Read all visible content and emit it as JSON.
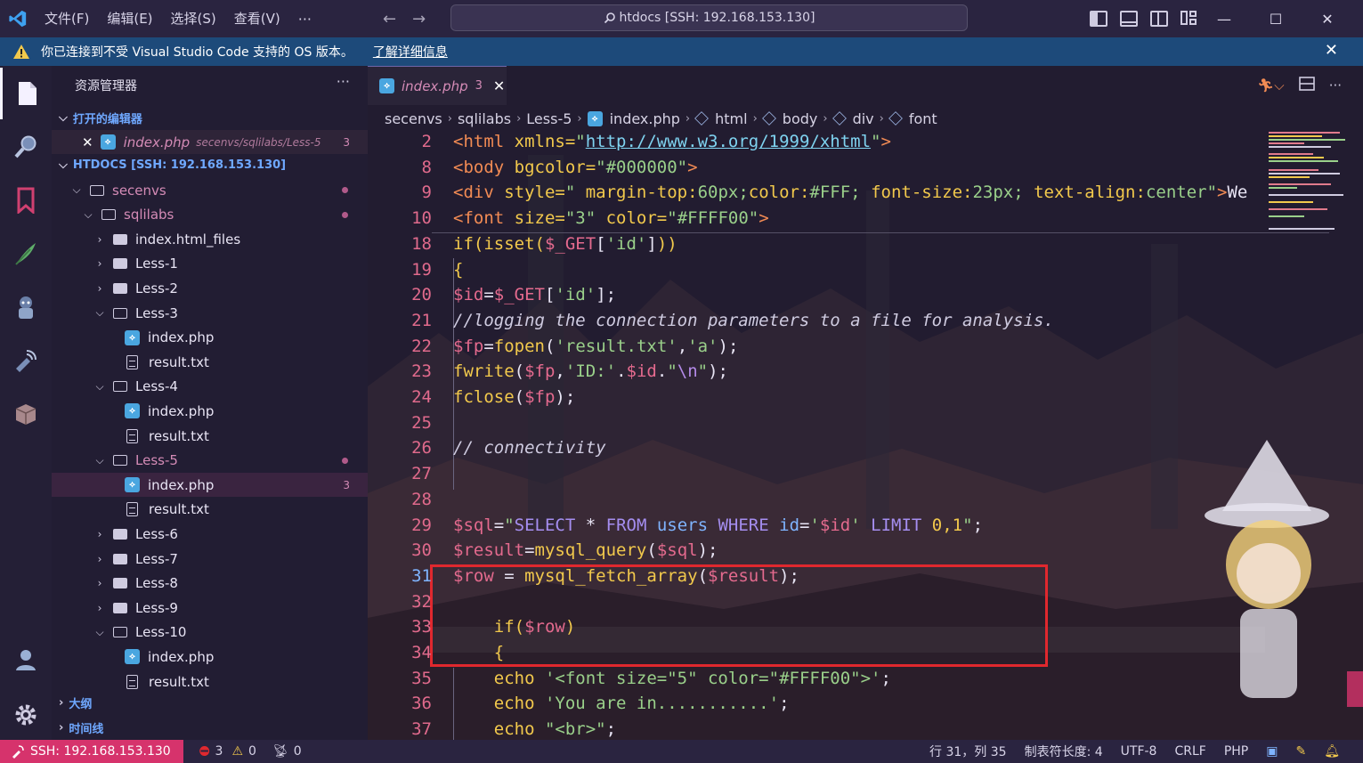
{
  "titlebar": {
    "menus": [
      "文件(F)",
      "编辑(E)",
      "选择(S)",
      "查看(V)"
    ],
    "more": "···",
    "search_text": "htdocs [SSH: 192.168.153.130]"
  },
  "notification": {
    "message": "你已连接到不受 Visual Studio Code 支持的 OS 版本。",
    "link": "了解详细信息"
  },
  "sidebar": {
    "title": "资源管理器",
    "more": "···",
    "open_editors_title": "打开的编辑器",
    "open_editor": {
      "name": "index.php",
      "path": "secenvs/sqlilabs/Less-5",
      "badge": "3"
    },
    "workspace_title": "HTDOCS [SSH: 192.168.153.130]",
    "tree": [
      {
        "label": "secenvs",
        "kind": "folder-open",
        "depth": 1,
        "modified": true
      },
      {
        "label": "sqlilabs",
        "kind": "folder-open",
        "depth": 2,
        "modified": true
      },
      {
        "label": "index.html_files",
        "kind": "folder",
        "depth": 3
      },
      {
        "label": "Less-1",
        "kind": "folder",
        "depth": 3
      },
      {
        "label": "Less-2",
        "kind": "folder",
        "depth": 3
      },
      {
        "label": "Less-3",
        "kind": "folder-open",
        "depth": 3
      },
      {
        "label": "index.php",
        "kind": "php",
        "depth": 4
      },
      {
        "label": "result.txt",
        "kind": "txt",
        "depth": 4
      },
      {
        "label": "Less-4",
        "kind": "folder-open",
        "depth": 3
      },
      {
        "label": "index.php",
        "kind": "php",
        "depth": 4
      },
      {
        "label": "result.txt",
        "kind": "txt",
        "depth": 4
      },
      {
        "label": "Less-5",
        "kind": "folder-open",
        "depth": 3,
        "modified": true
      },
      {
        "label": "index.php",
        "kind": "php",
        "depth": 4,
        "selected": true,
        "badge": "3"
      },
      {
        "label": "result.txt",
        "kind": "txt",
        "depth": 4
      },
      {
        "label": "Less-6",
        "kind": "folder",
        "depth": 3
      },
      {
        "label": "Less-7",
        "kind": "folder",
        "depth": 3
      },
      {
        "label": "Less-8",
        "kind": "folder",
        "depth": 3
      },
      {
        "label": "Less-9",
        "kind": "folder",
        "depth": 3
      },
      {
        "label": "Less-10",
        "kind": "folder-open",
        "depth": 3
      },
      {
        "label": "index.php",
        "kind": "php",
        "depth": 4
      },
      {
        "label": "result.txt",
        "kind": "txt",
        "depth": 4
      }
    ],
    "outline_title": "大纲",
    "timeline_title": "时间线"
  },
  "editor": {
    "tab": {
      "name": "index.php",
      "badge": "3",
      "close": "✕"
    },
    "breadcrumb": [
      "secenvs",
      "sqlilabs",
      "Less-5",
      "index.php",
      "html",
      "body",
      "div",
      "font"
    ],
    "lines": [
      {
        "n": "2",
        "tokens": [
          [
            "k-tag",
            "<html "
          ],
          [
            "k-attr",
            "xmlns="
          ],
          [
            "k-str",
            "\""
          ],
          [
            "k-url",
            "http://www.w3.org/1999/xhtml"
          ],
          [
            "k-str",
            "\""
          ],
          [
            "k-tag",
            ">"
          ]
        ]
      },
      {
        "n": "8",
        "tokens": [
          [
            "k-tag",
            "<body "
          ],
          [
            "k-attr",
            "bgcolor="
          ],
          [
            "k-str",
            "\"#000000\""
          ],
          [
            "k-tag",
            ">"
          ]
        ]
      },
      {
        "n": "9",
        "tokens": [
          [
            "k-tag",
            "<div "
          ],
          [
            "k-attr",
            "style="
          ],
          [
            "k-str",
            "\" "
          ],
          [
            "k-attr",
            "margin-top:"
          ],
          [
            "k-str",
            "60px;"
          ],
          [
            "k-attr",
            "color:"
          ],
          [
            "k-str",
            "#FFF; "
          ],
          [
            "k-attr",
            "font-size:"
          ],
          [
            "k-str",
            "23px; "
          ],
          [
            "k-attr",
            "text-align:"
          ],
          [
            "k-str",
            "center\""
          ],
          [
            "k-tag",
            ">"
          ],
          [
            "k-plain",
            "We"
          ]
        ]
      },
      {
        "n": "10",
        "tokens": [
          [
            "k-tag",
            "<font "
          ],
          [
            "k-attr",
            "size="
          ],
          [
            "k-str",
            "\"3\" "
          ],
          [
            "k-attr",
            "color="
          ],
          [
            "k-str",
            "\"#FFFF00\""
          ],
          [
            "k-tag",
            ">"
          ]
        ]
      },
      {
        "n": "18",
        "tokens": [
          [
            "k-fn",
            "if(isset("
          ],
          [
            "k-var",
            "$_GET"
          ],
          [
            "k-plain",
            "["
          ],
          [
            "k-str",
            "'id'"
          ],
          [
            "k-plain",
            "]"
          ],
          [
            "k-fn",
            "))"
          ]
        ]
      },
      {
        "n": "19",
        "tokens": [
          [
            "k-fn",
            "{"
          ]
        ]
      },
      {
        "n": "20",
        "tokens": [
          [
            "k-var",
            "$id"
          ],
          [
            "k-plain",
            "="
          ],
          [
            "k-var",
            "$_GET"
          ],
          [
            "k-plain",
            "["
          ],
          [
            "k-str",
            "'id'"
          ],
          [
            "k-plain",
            "];"
          ]
        ]
      },
      {
        "n": "21",
        "tokens": [
          [
            "k-cmt",
            "//logging the connection parameters to a file for analysis."
          ]
        ]
      },
      {
        "n": "22",
        "tokens": [
          [
            "k-var",
            "$fp"
          ],
          [
            "k-plain",
            "="
          ],
          [
            "k-fn",
            "fopen"
          ],
          [
            "k-plain",
            "("
          ],
          [
            "k-str",
            "'result.txt'"
          ],
          [
            "k-plain",
            ","
          ],
          [
            "k-str",
            "'a'"
          ],
          [
            "k-plain",
            ");"
          ]
        ]
      },
      {
        "n": "23",
        "tokens": [
          [
            "k-fn",
            "fwrite"
          ],
          [
            "k-plain",
            "("
          ],
          [
            "k-var",
            "$fp"
          ],
          [
            "k-plain",
            ","
          ],
          [
            "k-str",
            "'ID:'"
          ],
          [
            "k-plain",
            "."
          ],
          [
            "k-var",
            "$id"
          ],
          [
            "k-plain",
            "."
          ],
          [
            "k-str",
            "\""
          ],
          [
            "k-kw",
            "\\n"
          ],
          [
            "k-str",
            "\""
          ],
          [
            "k-plain",
            ");"
          ]
        ]
      },
      {
        "n": "24",
        "tokens": [
          [
            "k-fn",
            "fclose"
          ],
          [
            "k-plain",
            "("
          ],
          [
            "k-var",
            "$fp"
          ],
          [
            "k-plain",
            ");"
          ]
        ]
      },
      {
        "n": "25",
        "tokens": []
      },
      {
        "n": "26",
        "tokens": [
          [
            "k-cmt",
            "// connectivity"
          ]
        ]
      },
      {
        "n": "27",
        "tokens": []
      },
      {
        "n": "28",
        "tokens": []
      },
      {
        "n": "29",
        "tokens": [
          [
            "k-var",
            "$sql"
          ],
          [
            "k-plain",
            "="
          ],
          [
            "k-str",
            "\""
          ],
          [
            "k-sqlkw",
            "SELECT "
          ],
          [
            "k-plain",
            "* "
          ],
          [
            "k-sqlkw",
            "FROM "
          ],
          [
            "k-ident",
            "users "
          ],
          [
            "k-sqlkw",
            "WHERE "
          ],
          [
            "k-ident",
            "id"
          ],
          [
            "k-plain",
            "="
          ],
          [
            "k-str",
            "'"
          ],
          [
            "k-var",
            "$id"
          ],
          [
            "k-str",
            "' "
          ],
          [
            "k-sqlkw",
            "LIMIT "
          ],
          [
            "k-num",
            "0,1"
          ],
          [
            "k-str",
            "\""
          ],
          [
            "k-plain",
            ";"
          ]
        ]
      },
      {
        "n": "30",
        "tokens": [
          [
            "k-var",
            "$result"
          ],
          [
            "k-plain",
            "="
          ],
          [
            "k-fn",
            "mysql_query"
          ],
          [
            "k-plain",
            "("
          ],
          [
            "k-var",
            "$sql"
          ],
          [
            "k-plain",
            ");"
          ]
        ]
      },
      {
        "n": "31",
        "tokens": [
          [
            "k-var",
            "$row "
          ],
          [
            "k-plain",
            "= "
          ],
          [
            "k-fn",
            "mysql_fetch_array"
          ],
          [
            "k-plain",
            "("
          ],
          [
            "k-var",
            "$result"
          ],
          [
            "k-plain",
            ");"
          ]
        ]
      },
      {
        "n": "32",
        "tokens": []
      },
      {
        "n": "33",
        "tokens": [
          [
            "k-plain",
            "    "
          ],
          [
            "k-fn",
            "if("
          ],
          [
            "k-var",
            "$row"
          ],
          [
            "k-fn",
            ")"
          ]
        ]
      },
      {
        "n": "34",
        "tokens": [
          [
            "k-plain",
            "    "
          ],
          [
            "k-fn",
            "{"
          ]
        ]
      },
      {
        "n": "35",
        "tokens": [
          [
            "k-plain",
            "    "
          ],
          [
            "k-fn",
            "echo "
          ],
          [
            "k-str",
            "'<font size=\"5\" color=\"#FFFF00\">'"
          ],
          [
            "k-plain",
            ";"
          ]
        ]
      },
      {
        "n": "36",
        "tokens": [
          [
            "k-plain",
            "    "
          ],
          [
            "k-fn",
            "echo "
          ],
          [
            "k-str",
            "'You are in...........'"
          ],
          [
            "k-plain",
            ";"
          ]
        ]
      },
      {
        "n": "37",
        "tokens": [
          [
            "k-plain",
            "    "
          ],
          [
            "k-fn",
            "echo "
          ],
          [
            "k-str",
            "\"<br>\""
          ],
          [
            "k-plain",
            ";"
          ]
        ]
      }
    ],
    "current_line": "31"
  },
  "statusbar": {
    "remote": "SSH: 192.168.153.130",
    "errors": "3",
    "warnings": "0",
    "ports": "0",
    "position": "行 31，列 35",
    "tab_size": "制表符长度: 4",
    "encoding": "UTF-8",
    "eol": "CRLF",
    "language": "PHP"
  },
  "colors": {
    "accent_remote": "#d6336c",
    "notification": "#1d4a7a",
    "highlight_box": "#e0282e"
  }
}
